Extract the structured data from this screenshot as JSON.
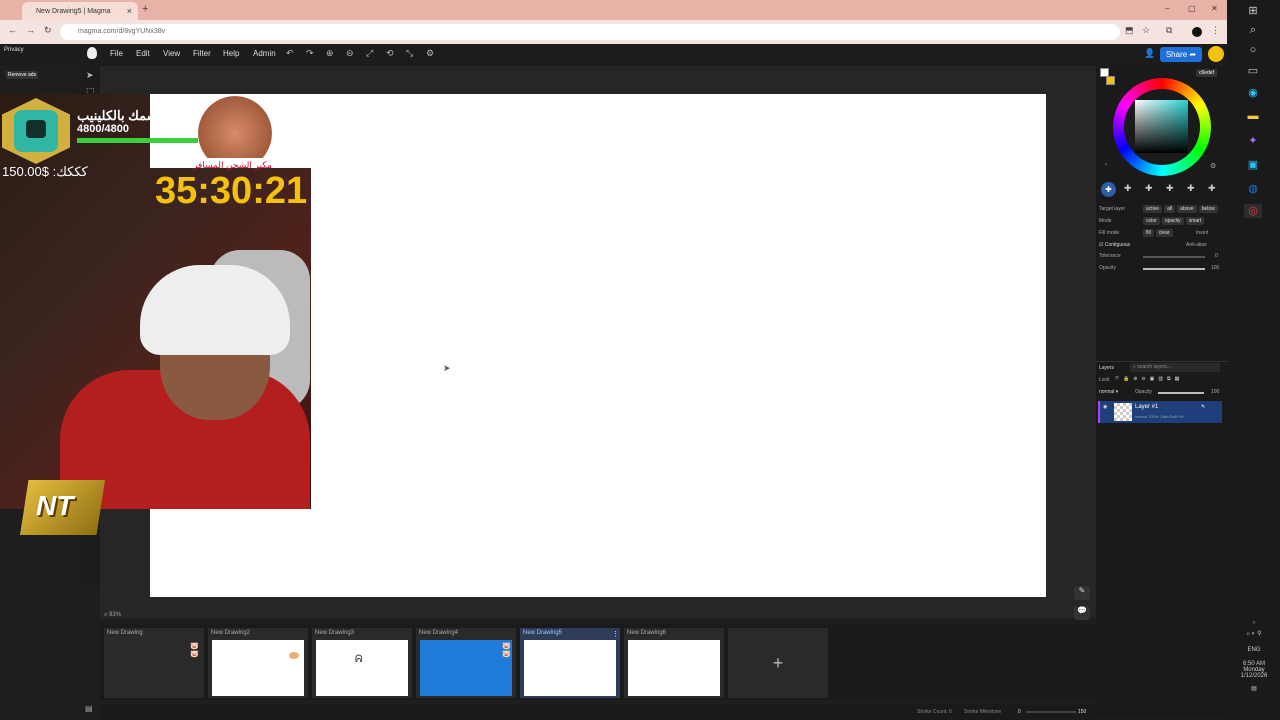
{
  "browser": {
    "tab_title": "New Drawing5 | Magma",
    "tab_close": "×",
    "new_tab": "+",
    "url": "magma.com/d/8vgYUNx38v",
    "win_min": "–",
    "win_max": "▢",
    "win_close": "✕"
  },
  "menu": {
    "items": [
      "File",
      "Edit",
      "View",
      "Filter",
      "Help",
      "Admin"
    ],
    "share": "Share"
  },
  "overlay": {
    "privacy": "Privacy",
    "remove_ads": "Remove ads",
    "name": "سمك بالكلينيب",
    "score": "4800/4800",
    "score_fraction": 1.0,
    "money": "150.00$ :كككك",
    "timer": "35:30:21",
    "logo_text": "NT",
    "arabic_banner": "مكبر الشحن المسافر"
  },
  "color": {
    "hex": "c6edef",
    "accent": "#2ad2d2"
  },
  "tool_options": {
    "target_layer": "Target layer",
    "target_opts": [
      "active",
      "all",
      "above",
      "below"
    ],
    "mode": "Mode",
    "mode_opts": [
      "color",
      "opacity",
      "smart"
    ],
    "fill_mode": "Fill mode",
    "fill_opts": [
      "fill",
      "clear"
    ],
    "invert": "Invert",
    "contiguous": "Contiguous",
    "anti_alias": "Anti-alias",
    "tolerance": "Tolerance",
    "tolerance_val": "0",
    "opacity": "Opacity",
    "opacity_val": "100"
  },
  "layers": {
    "title": "Layers",
    "search_placeholder": "search layers...",
    "lock": "Lock",
    "blend": "normal",
    "opacity_label": "Opacity",
    "opacity_val": "100",
    "layer_name": "Layer #1",
    "layer_meta": "normal 100% | MecTroN 99"
  },
  "zoom": "93%",
  "drawings": [
    {
      "name": "New Drawing"
    },
    {
      "name": "New Drawing2"
    },
    {
      "name": "New Drawing3"
    },
    {
      "name": "New Drawing4"
    },
    {
      "name": "New Drawing5"
    },
    {
      "name": "New Drawing6"
    }
  ],
  "add_drawing": "+",
  "status": {
    "stroke_count": "Stroke Count: 0",
    "stroke_milestone": "Stroke Milestone",
    "milestone_start": "0",
    "milestone_end": "150"
  },
  "tray": {
    "lang": "ENG",
    "time": "6:50 AM",
    "day": "Monday",
    "date": "1/12/2026"
  }
}
